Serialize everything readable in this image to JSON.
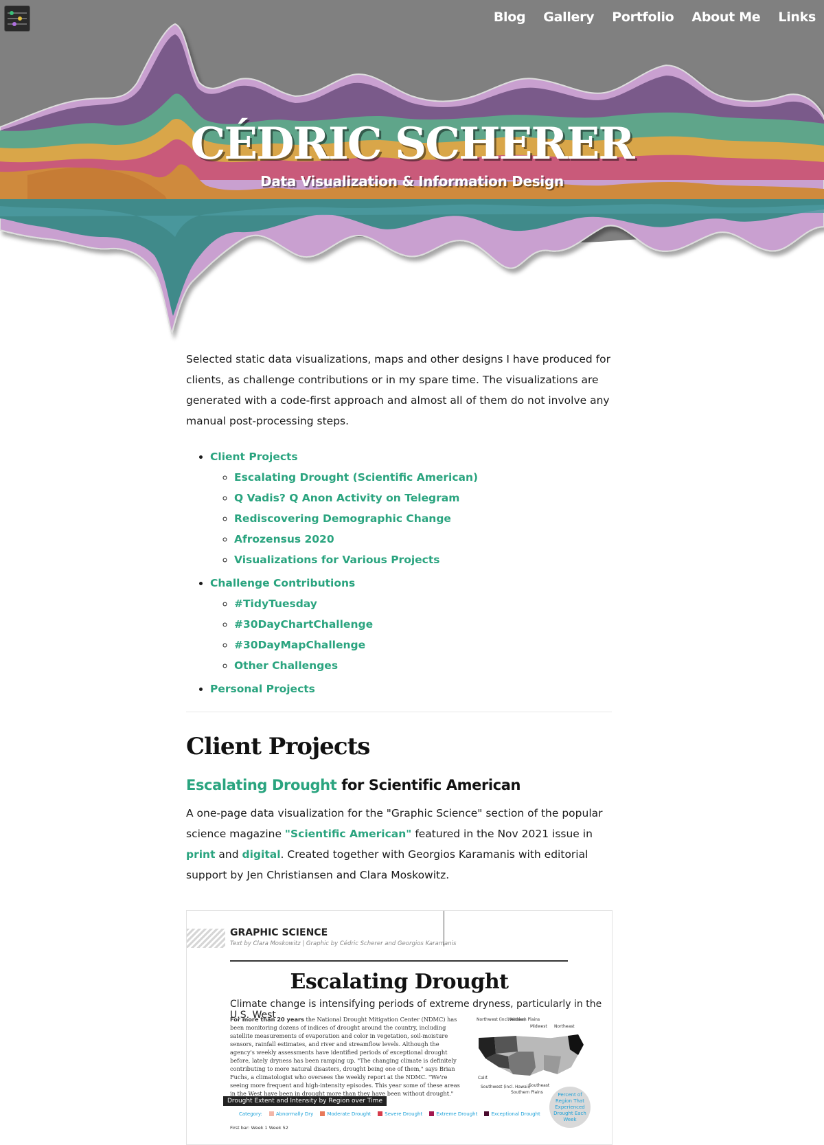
{
  "nav": {
    "items": [
      "Blog",
      "Gallery",
      "Portfolio",
      "About Me",
      "Links"
    ]
  },
  "hero": {
    "title": "CÉDRIC SCHERER",
    "subtitle": "Data Visualization & Information Design"
  },
  "intro": "Selected static data visualizations, maps and other designs I have produced for clients, as challenge contributions or in my spare time. The visualizations are generated with a code-first approach and almost all of them do not involve any manual post-processing steps.",
  "toc": {
    "client": "Client Projects",
    "client_items": [
      "Escalating Drought (Scientific American)",
      "Q Vadis? Q Anon Activity on Telegram",
      "Rediscovering Demographic Change",
      "Afrozensus 2020",
      "Visualizations for Various Projects"
    ],
    "challenge": "Challenge Contributions",
    "challenge_items": [
      "#TidyTuesday",
      "#30DayChartChallenge",
      "#30DayMapChallenge",
      "Other Challenges"
    ],
    "personal": "Personal Projects"
  },
  "section": {
    "title": "Client Projects",
    "project_link": "Escalating Drought",
    "project_rest": " for Scientific American",
    "desc": {
      "t1": "A one-page data visualization for the \"Graphic Science\" section of the popular science magazine ",
      "link_sa": "\"Scientific American\"",
      "t2": " featured in the Nov 2021 issue in ",
      "link_print": "print",
      "t3": " and ",
      "link_digital": "digital",
      "t4": ". Created together with Georgios Karamanis with editorial support by Jen Christiansen and Clara Moskowitz."
    }
  },
  "poster": {
    "section_head": "GRAPHIC SCIENCE",
    "byline": "Text by Clara Moskowitz | Graphic by Cédric Scherer and Georgios Karamanis",
    "title": "Escalating Drought",
    "subtitle": "Climate change is intensifying periods of extreme dryness, particularly in the U.S. West",
    "body_lead": "For more than 20 years",
    "body": " the National Drought Mitigation Center (NDMC) has been monitoring dozens of indices of drought around the country, including satellite measurements of evaporation and color in vegetation, soil-moisture sensors, rainfall estimates, and river and streamflow levels. Although the agency's weekly assessments have identified periods of exceptional drought before, lately dryness has been ramping up. \"The changing climate is definitely contributing to more natural disasters, drought being one of them,\" says Brian Fuchs, a climatologist who oversees the weekly report at the NDMC. \"We're seeing more frequent and high-intensity episodes. This year some of these areas in the West have been in drought more than they have been without drought.\"",
    "bar_title": "Drought Extent and Intensity by Region over Time",
    "category_label": "Category:",
    "categories": [
      {
        "name": "Abnormally Dry",
        "color": "#f2b6a8"
      },
      {
        "name": "Moderate Drought",
        "color": "#e8795a"
      },
      {
        "name": "Severe Drought",
        "color": "#d63b4a"
      },
      {
        "name": "Extreme Drought",
        "color": "#a3174f"
      },
      {
        "name": "Exceptional Drought",
        "color": "#4a0a2e"
      }
    ],
    "circle_text": "Percent of Region That Experienced Drought Each Week",
    "first_bar": "First bar: Week 1    Week 52",
    "map_labels": [
      "Northwest (incl. Alaska)",
      "Northern Plains",
      "Midwest",
      "Northeast",
      "Calif.",
      "Southwest (incl. Hawaii)",
      "Southern Plains",
      "Southeast"
    ]
  },
  "colors": {
    "accent": "#2aa47f",
    "hero_bg": "#808080"
  }
}
